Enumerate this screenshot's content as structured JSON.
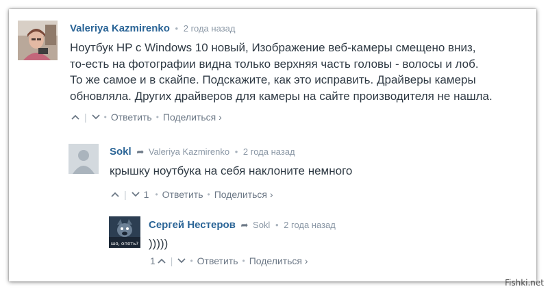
{
  "comments": [
    {
      "author": "Valeriya Kazmirenko",
      "time": "2 года назад",
      "text": "Ноутбук HP с Windows 10 новый, Изображение веб-камеры смещено вниз,\nто-есть на фотографии видна только верхняя часть головы - волосы и лоб.\nТо же самое и в скайпе. Подскажите, как это исправить. Драйверы камеры\nобновляла. Других драйверов для камеры на сайте производителя не нашла.",
      "upvotes": "",
      "reply": "Ответить",
      "share": "Поделиться ›"
    },
    {
      "author": "Sokl",
      "reply_to": "Valeriya Kazmirenko",
      "time": "2 года назад",
      "text": "крышку ноутбука на себя наклоните немного",
      "downvotes": "1",
      "reply": "Ответить",
      "share": "Поделиться ›"
    },
    {
      "author": "Сергей Нестеров",
      "reply_to": "Sokl",
      "time": "2 года назад",
      "text": ")))))",
      "upvotes": "1",
      "avatar_caption": "шо, опять?",
      "reply": "Ответить",
      "share": "Поделиться ›"
    }
  ],
  "watermark": "Fishki.net",
  "icons": {
    "upvote": "chevron-up-icon",
    "downvote": "chevron-down-icon",
    "reply_arrow": "reply-arrow-icon"
  },
  "colors": {
    "author": "#2a6496",
    "meta": "#8a97a5",
    "body": "#2f3a44"
  }
}
